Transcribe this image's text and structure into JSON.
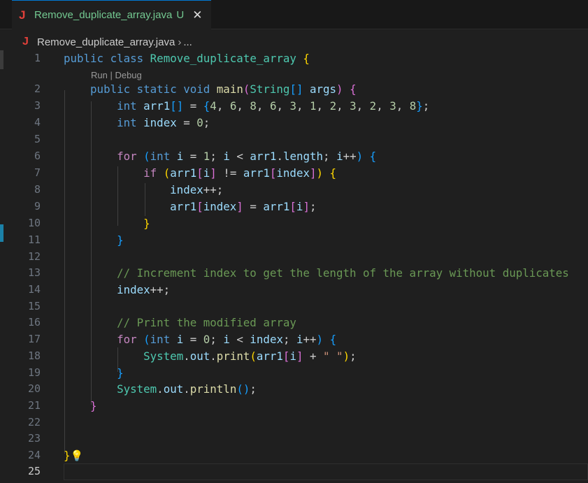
{
  "tab": {
    "icon": "J",
    "filename": "Remove_duplicate_array.java",
    "status": "U",
    "close": "✕"
  },
  "breadcrumb": {
    "icon": "J",
    "file": "Remove_duplicate_array.java",
    "separator": "›",
    "rest": "..."
  },
  "codelens": "Run | Debug",
  "line_numbers": [
    "1",
    "2",
    "3",
    "4",
    "5",
    "6",
    "7",
    "8",
    "9",
    "10",
    "11",
    "12",
    "13",
    "14",
    "15",
    "16",
    "17",
    "18",
    "19",
    "20",
    "21",
    "22",
    "23",
    "24",
    "25"
  ],
  "colors": {
    "keyword": "#569cd6",
    "control": "#c586c0",
    "type": "#4ec9b0",
    "function": "#dcdcaa",
    "variable": "#9cdcfe",
    "number": "#b5cea8",
    "string": "#ce9178",
    "comment": "#6a9955",
    "untracked": "#73c991"
  },
  "code_lines": [
    [
      [
        "kw",
        "public"
      ],
      [
        "",
        "  "
      ],
      [
        "kw",
        "class"
      ],
      [
        "",
        "  "
      ],
      [
        "ty",
        "Remove_duplicate_array"
      ],
      [
        "",
        " "
      ],
      [
        "b1",
        "{"
      ]
    ],
    [
      [
        "",
        ""
      ]
    ],
    [
      [
        "",
        ""
      ]
    ]
  ],
  "code": {
    "l1": {
      "kw1": "public",
      "kw2": "class",
      "cls": "Remove_duplicate_array",
      "brace": "{"
    },
    "l2": {
      "kw1": "public",
      "kw2": "static",
      "kw3": "void",
      "fn": "main",
      "p1": "(",
      "ty": "String",
      "arr": "[]",
      "var": "args",
      "p2": ")",
      "brace": "{"
    },
    "l3": {
      "kw": "int",
      "var": "arr1",
      "arr": "[]",
      "eq": "=",
      "open": "{",
      "nums": [
        "4",
        "6",
        "8",
        "6",
        "3",
        "1",
        "2",
        "3",
        "2",
        "3",
        "8"
      ],
      "close": "}",
      "semi": ";"
    },
    "l4": {
      "kw": "int",
      "var": "index",
      "eq": "=",
      "num": "0",
      "semi": ";"
    },
    "l6": {
      "kw": "for",
      "p1": "(",
      "ty": "int",
      "v1": "i",
      "eq": "=",
      "n1": "1",
      "v2": "i",
      "lt": "<",
      "v3": "arr1",
      "dot": ".",
      "len": "length",
      "v4": "i",
      "inc": "++",
      "p2": ")",
      "brace": "{"
    },
    "l7": {
      "kw": "if",
      "p1": "(",
      "v1": "arr1",
      "b1": "[",
      "i": "i",
      "b2": "]",
      "ne": "!=",
      "v2": "arr1",
      "b3": "[",
      "idx": "index",
      "b4": "]",
      "p2": ")",
      "brace": "{"
    },
    "l8": {
      "var": "index",
      "inc": "++",
      "semi": ";"
    },
    "l9": {
      "v1": "arr1",
      "b1": "[",
      "idx": "index",
      "b2": "]",
      "eq": "=",
      "v2": "arr1",
      "b3": "[",
      "i": "i",
      "b4": "]",
      "semi": ";"
    },
    "l10": {
      "brace": "}"
    },
    "l11": {
      "brace": "}"
    },
    "l13": {
      "comment": "// Increment index to get the length of the array without duplicates"
    },
    "l14": {
      "var": "index",
      "inc": "++",
      "semi": ";"
    },
    "l16": {
      "comment": "// Print the modified array"
    },
    "l17": {
      "kw": "for",
      "p1": "(",
      "ty": "int",
      "v1": "i",
      "eq": "=",
      "n": "0",
      "v2": "i",
      "lt": "<",
      "v3": "index",
      "v4": "i",
      "inc": "++",
      "p2": ")",
      "brace": "{"
    },
    "l18": {
      "ty": "System",
      "out": "out",
      "fn": "print",
      "p1": "(",
      "v": "arr1",
      "b1": "[",
      "i": "i",
      "b2": "]",
      "plus": "+",
      "str": "\" \"",
      "p2": ")",
      "semi": ";"
    },
    "l19": {
      "brace": "}"
    },
    "l20": {
      "ty": "System",
      "out": "out",
      "fn": "println",
      "p": "()",
      "semi": ";"
    },
    "l21": {
      "brace": "}"
    },
    "l24": {
      "brace": "}",
      "bulb": "💡"
    }
  }
}
